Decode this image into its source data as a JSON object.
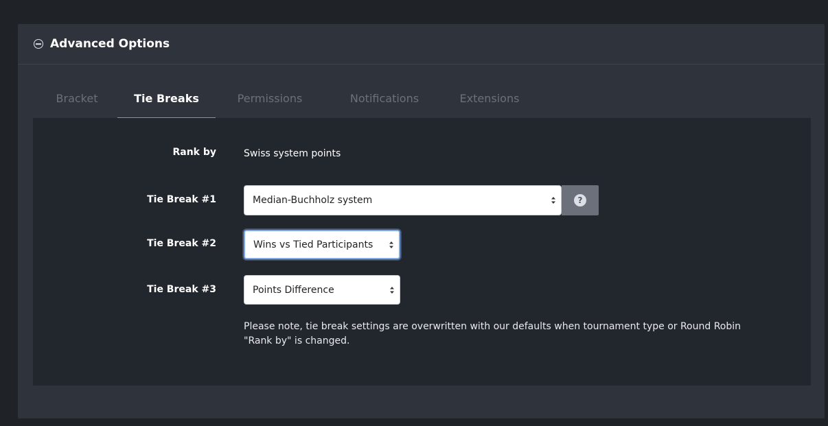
{
  "panel": {
    "title": "Advanced Options",
    "collapse_icon": "minus-circle-icon"
  },
  "tabs": [
    {
      "label": "Bracket",
      "active": false
    },
    {
      "label": "Tie Breaks",
      "active": true
    },
    {
      "label": "Permissions",
      "active": false
    },
    {
      "label": "Notifications",
      "active": false
    },
    {
      "label": "Extensions",
      "active": false
    }
  ],
  "form": {
    "rank_by": {
      "label": "Rank by",
      "value": "Swiss system points"
    },
    "tie_break_1": {
      "label": "Tie Break #1",
      "value": "Median-Buchholz system",
      "help_icon": "?"
    },
    "tie_break_2": {
      "label": "Tie Break #2",
      "value": "Wins vs Tied Participants"
    },
    "tie_break_3": {
      "label": "Tie Break #3",
      "value": "Points Difference"
    },
    "note": "Please note, tie break settings are overwritten with our defaults when tournament type or Round Robin \"Rank by\" is changed."
  },
  "colors": {
    "accent": "#f2733c",
    "panel_bg": "#2f333b",
    "content_bg": "#22262d",
    "page_bg": "#1f2227"
  }
}
